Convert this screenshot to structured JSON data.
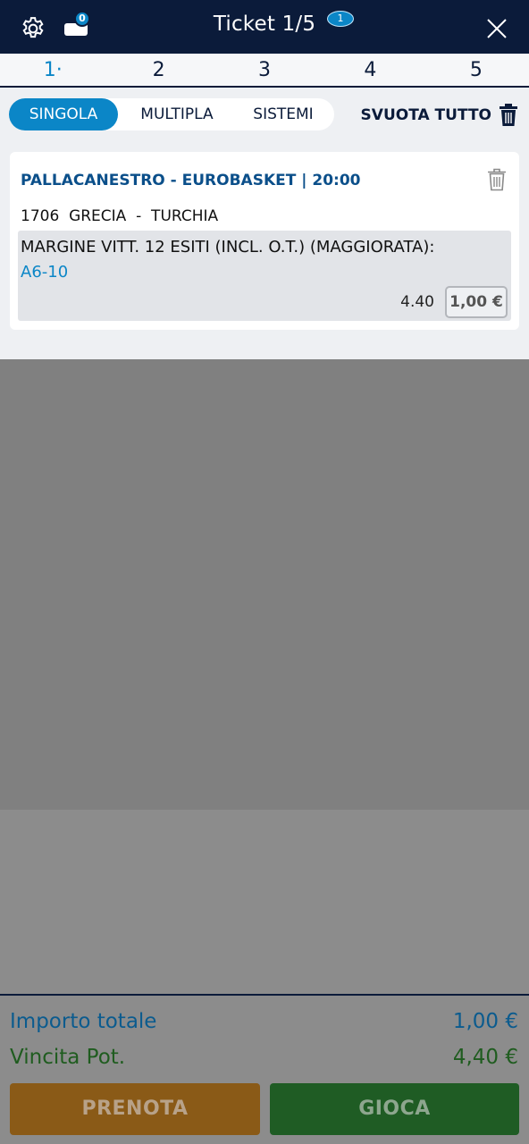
{
  "header": {
    "title": "Ticket 1/5",
    "title_badge": "1",
    "ticket_badge": "0"
  },
  "tabs": [
    "1·",
    "2",
    "3",
    "4",
    "5"
  ],
  "modes": {
    "singola": "SINGOLA",
    "multipla": "MULTIPLA",
    "sistemi": "SISTEMI"
  },
  "clear_all": "SVUOTA TUTTO",
  "bet": {
    "event": "PALLACANESTRO - EUROBASKET | 20:00",
    "match": "1706  GRECIA  -  TURCHIA",
    "market": "MARGINE VITT. 12 ESITI (INCL. O.T.) (MAGGIORATA):",
    "outcome": "A6-10",
    "odds": "4.40",
    "stake": "1,00 €"
  },
  "footer": {
    "total_label": "Importo totale",
    "total_value": "1,00 €",
    "win_label": "Vincita Pot.",
    "win_value": "4,40 €",
    "book_label": "PRENOTA",
    "play_label": "GIOCA"
  },
  "colors": {
    "header_bg": "#0b1b3a",
    "accent": "#0b86c7",
    "book_button": "#8a5a17",
    "play_button": "#1f5c24"
  }
}
